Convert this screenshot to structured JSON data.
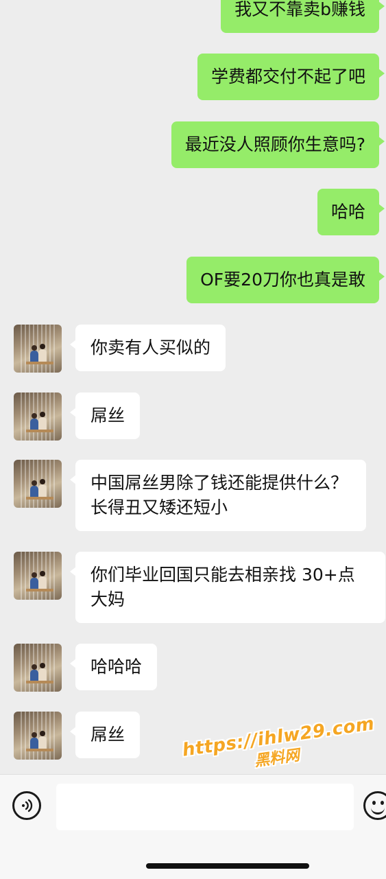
{
  "sent_messages": [
    "我又不靠卖b赚钱",
    "学费都交付不起了吧",
    "最近没人照顾你生意吗?",
    "哈哈",
    "OF要20刀你也真是敢"
  ],
  "received_messages": [
    "你卖有人买似的",
    "屌丝",
    "中国屌丝男除了钱还能提供什么？长得丑又矮还短小",
    "你们毕业回国只能去相亲找 30+点大妈",
    "哈哈哈",
    "屌丝"
  ],
  "input_bar": {
    "voice_icon": "voice-icon",
    "emoji_icon": "emoji-icon",
    "text_value": ""
  },
  "watermark": {
    "url": "https://ihlw29.com",
    "name": "黑料网"
  },
  "colors": {
    "sent_bubble": "#95ec69",
    "received_bubble": "#ffffff",
    "chat_background": "#ededed",
    "watermark": "#f5a623"
  }
}
